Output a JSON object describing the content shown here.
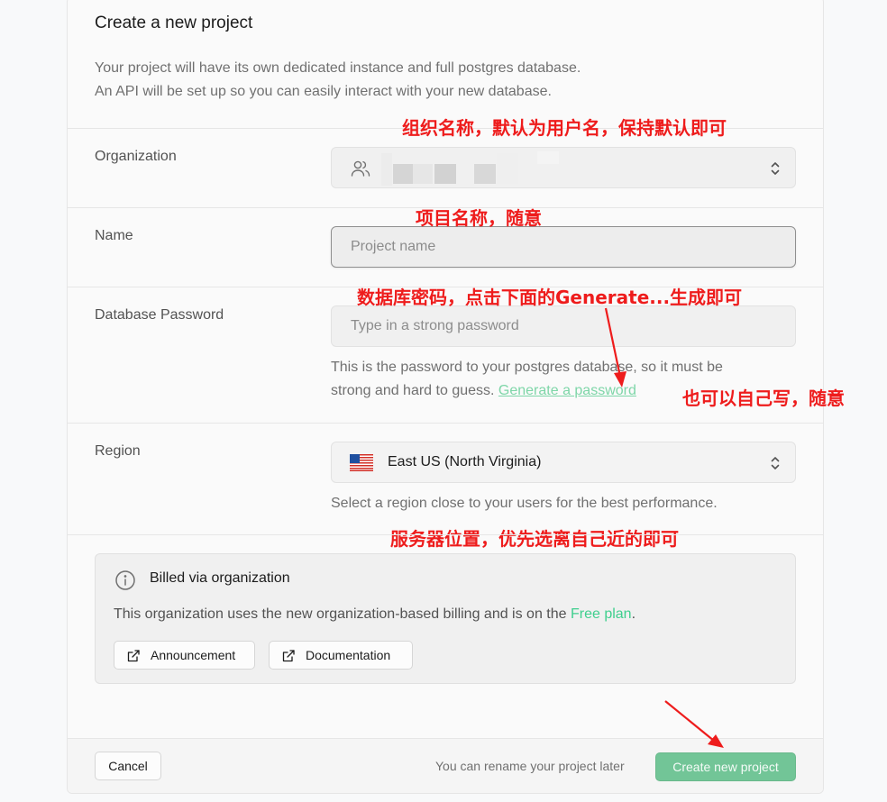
{
  "form": {
    "title": "Create a new project",
    "intro_line1": "Your project will have its own dedicated instance and full postgres database.",
    "intro_line2": "An API will be set up so you can easily interact with your new database."
  },
  "organization": {
    "label": "Organization"
  },
  "name": {
    "label": "Name",
    "placeholder": "Project name"
  },
  "password": {
    "label": "Database Password",
    "placeholder": "Type in a strong password",
    "help_line1": "This is the password to your postgres database, so it must be",
    "help_line2": "strong and hard to guess.",
    "generate_link": "Generate a password"
  },
  "region": {
    "label": "Region",
    "value": "East US (North Virginia)",
    "help": "Select a region close to your users for the best performance."
  },
  "billing": {
    "title": "Billed via organization",
    "text_before": "This organization uses the new organization-based billing and is on the ",
    "plan_link": "Free plan",
    "text_after": ".",
    "announcement_label": "Announcement",
    "documentation_label": "Documentation"
  },
  "footer": {
    "cancel_label": "Cancel",
    "rename_note": "You can rename your project later",
    "create_label": "Create new project"
  },
  "annotations": {
    "org_note": "组织名称，默认为用户名，保持默认即可",
    "name_note": "项目名称，随意",
    "password_note": "数据库密码，点击下面的Generate...生成即可",
    "password_note2": "也可以自己写，随意",
    "region_note": "服务器位置，优先选离自己近的即可"
  },
  "colors": {
    "annotation": "#ee1c1c",
    "brand_green": "#3fcf8e",
    "create_button": "#72c597"
  }
}
